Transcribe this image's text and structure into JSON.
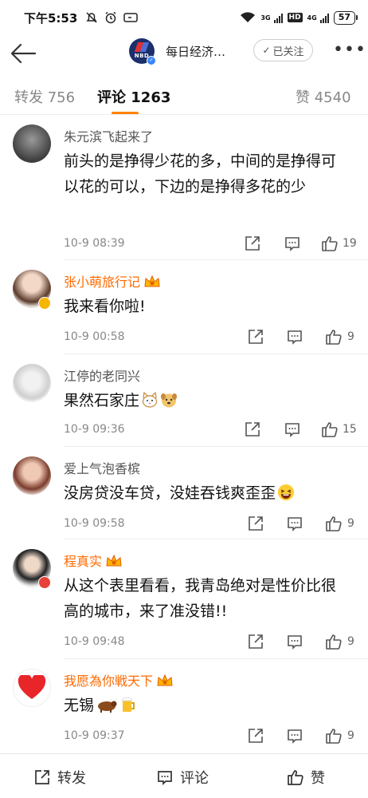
{
  "status_bar": {
    "time": "下午5:53",
    "network_1": "3G",
    "network_2": "4G",
    "hd": "HD",
    "battery": "57"
  },
  "nav": {
    "title": "每日经济…",
    "follow_label": "已关注",
    "logo_text": "NBD"
  },
  "tabs": [
    {
      "label": "转发 756"
    },
    {
      "label": "评论 1263"
    },
    {
      "label": "赞 4540"
    }
  ],
  "comments": [
    {
      "author": "朱元滨飞起来了",
      "vip": false,
      "text": "前头的是挣得少花的多，中间的是挣得可以花的可以，下边的是挣得多花的少",
      "time": "10-9 08:39",
      "likes": "19"
    },
    {
      "author": "张小萌旅行记",
      "vip": true,
      "text": "我来看你啦!",
      "time": "10-9 00:58",
      "likes": "9"
    },
    {
      "author": "江停的老同兴",
      "vip": false,
      "text": "果然石家庄",
      "time": "10-9 09:36",
      "likes": "15"
    },
    {
      "author": "爱上气泡香槟",
      "vip": false,
      "text": "没房贷没车贷，没娃吞钱爽歪歪",
      "time": "10-9 09:58",
      "likes": "9"
    },
    {
      "author": "程真实",
      "vip": true,
      "text": "从这个表里看看，我青岛绝对是性价比很高的城市，来了准没错!!",
      "time": "10-9 09:48",
      "likes": "9"
    },
    {
      "author": "我愿為你戦天下",
      "vip": true,
      "text": "无锡",
      "time": "10-9 09:37",
      "likes": "9"
    }
  ],
  "bottom_bar": {
    "repost_label": "转发",
    "comment_label": "评论",
    "like_label": "赞"
  },
  "colors": {
    "accent": "#ff8200",
    "vip_name": "#ff6a00",
    "muted": "#888888"
  }
}
